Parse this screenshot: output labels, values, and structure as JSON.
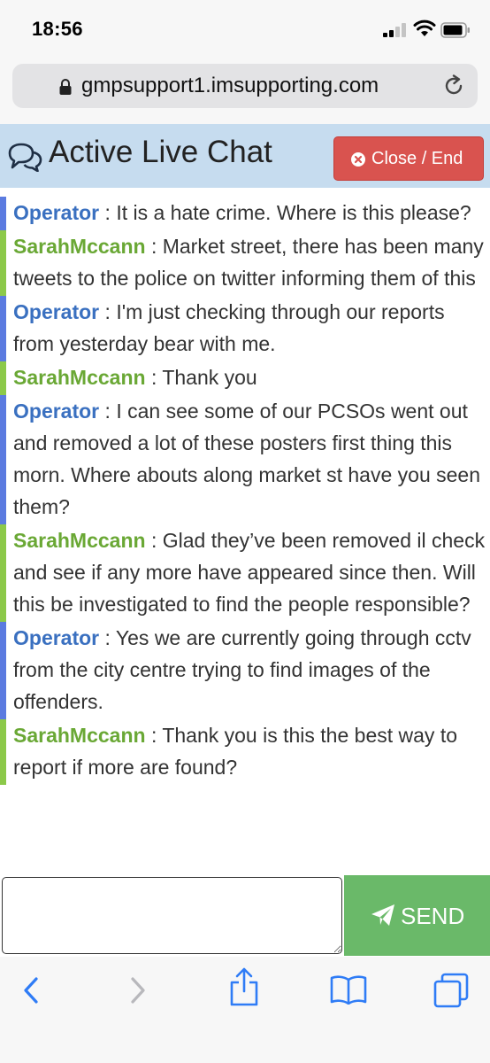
{
  "status": {
    "time": "18:56"
  },
  "browser": {
    "url": "gmpsupport1.imsupporting.com"
  },
  "chat": {
    "title": "Active Live Chat",
    "close_label": "Close / End",
    "messages": [
      {
        "sender": "Operator",
        "role": "operator",
        "text": "It is a hate crime. Where is this please?"
      },
      {
        "sender": "SarahMccann",
        "role": "user",
        "text": "Market street, there has been many tweets to the police on twitter informing them of this"
      },
      {
        "sender": "Operator",
        "role": "operator",
        "text": "I'm just checking through our reports from yesterday bear with me."
      },
      {
        "sender": "SarahMccann",
        "role": "user",
        "text": "Thank you"
      },
      {
        "sender": "Operator",
        "role": "operator",
        "text": "I can see some of our PCSOs went out and removed a lot of these posters first thing this morn. Where abouts along market st have you seen them?"
      },
      {
        "sender": "SarahMccann",
        "role": "user",
        "text": "Glad they’ve been removed il check and see if any more have appeared since then. Will this be investigated to find the people responsible?"
      },
      {
        "sender": "Operator",
        "role": "operator",
        "text": "Yes we are currently going through cctv from the city centre trying to find images of the offenders."
      },
      {
        "sender": "SarahMccann",
        "role": "user",
        "text": "Thank you is this the best way to report if more are found?"
      }
    ],
    "input": {
      "value": "",
      "placeholder": ""
    },
    "send_label": "SEND"
  },
  "colors": {
    "operator": "#3a70c0",
    "user": "#6aa835",
    "operator_bar": "#5b7be0",
    "user_bar": "#8cc94a",
    "close_button": "#d9534f",
    "send_button": "#6ab969",
    "header_bg": "#c6dcef"
  },
  "toolbar": {
    "icons": [
      "back-icon",
      "forward-icon",
      "share-icon",
      "bookmarks-icon",
      "tabs-icon"
    ]
  }
}
